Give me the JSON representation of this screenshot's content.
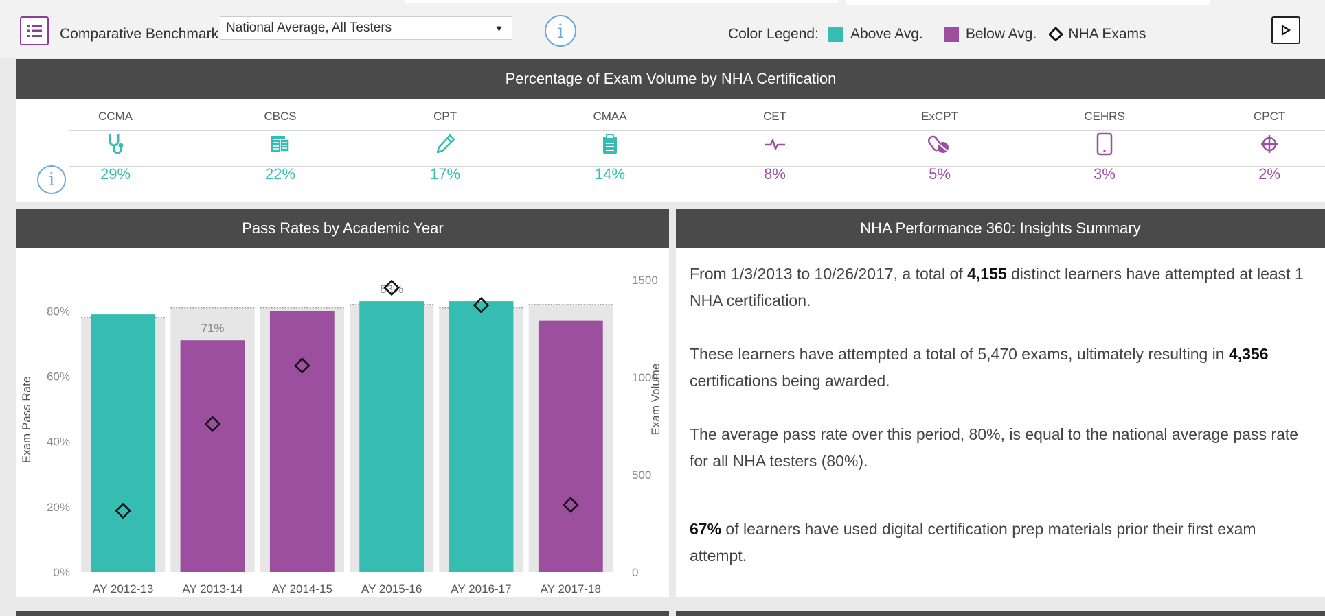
{
  "toolbar": {
    "benchmark_label": "Comparative Benchmark:",
    "benchmark_value": "National Average, All Testers",
    "legend_label": "Color Legend:",
    "legend_above": "Above Avg.",
    "legend_below": "Below Avg.",
    "legend_exams": "NHA Exams"
  },
  "colors": {
    "above": "#36bdb2",
    "below": "#9b4f9e",
    "header": "#4a4a4a",
    "info": "#6aa9d8"
  },
  "volume_panel": {
    "title": "Percentage of Exam Volume by NHA Certification",
    "certs": [
      {
        "name": "CCMA",
        "pct": "29%",
        "icon": "stethoscope-icon",
        "status": "above"
      },
      {
        "name": "CBCS",
        "pct": "22%",
        "icon": "billing-document-icon",
        "status": "above"
      },
      {
        "name": "CPT",
        "pct": "17%",
        "icon": "syringe-icon",
        "status": "above"
      },
      {
        "name": "CMAA",
        "pct": "14%",
        "icon": "clipboard-icon",
        "status": "above"
      },
      {
        "name": "CET",
        "pct": "8%",
        "icon": "heartbeat-icon",
        "status": "below"
      },
      {
        "name": "ExCPT",
        "pct": "5%",
        "icon": "pills-icon",
        "status": "below"
      },
      {
        "name": "CEHRS",
        "pct": "3%",
        "icon": "tablet-icon",
        "status": "below"
      },
      {
        "name": "CPCT",
        "pct": "2%",
        "icon": "ekg-leads-icon",
        "status": "below"
      }
    ]
  },
  "pass_panel": {
    "title": "Pass Rates by Academic Year"
  },
  "chart_data": {
    "type": "bar",
    "title": "Pass Rates by Academic Year",
    "categories": [
      "AY 2012-13",
      "AY 2013-14",
      "AY 2014-15",
      "AY 2015-16",
      "AY 2016-17",
      "AY 2017-18"
    ],
    "series": [
      {
        "name": "Exam Pass Rate",
        "values": [
          79,
          71,
          80,
          83,
          83,
          77
        ],
        "status": [
          "above",
          "below",
          "below",
          "above",
          "above",
          "below"
        ]
      },
      {
        "name": "NHA Exams",
        "values": [
          315,
          760,
          1060,
          1460,
          1370,
          345
        ]
      }
    ],
    "benchmark": [
      78,
      81,
      81,
      82,
      81,
      82
    ],
    "data_labels": {
      "1": "71%",
      "3": "83%"
    },
    "ylabel": "Exam Pass Rate",
    "y2label": "Exam Volume",
    "ylim": [
      0,
      95
    ],
    "y2lim": [
      0,
      1500
    ],
    "yticks": [
      "0%",
      "20%",
      "40%",
      "60%",
      "80%"
    ],
    "y2ticks": [
      "0",
      "500",
      "1000",
      "1500"
    ],
    "grid": false,
    "legend": "top"
  },
  "insights_panel": {
    "title": "NHA Performance 360:  Insights Summary",
    "p1_a": "From 1/3/2013 to 10/26/2017, a total of ",
    "p1_b": "4,155",
    "p1_c": " distinct learners have attempted at least 1 NHA certification.",
    "p2_a": "These learners have attempted a total of 5,470 exams, ultimately resulting in ",
    "p2_b": "4,356",
    "p2_c": " certifications being awarded.",
    "p3": "The average pass rate over this period, 80%, is equal to the national average pass rate for all NHA testers (80%).",
    "p4_a": "67%",
    "p4_b": " of learners have used digital certification prep materials prior their first exam attempt."
  }
}
